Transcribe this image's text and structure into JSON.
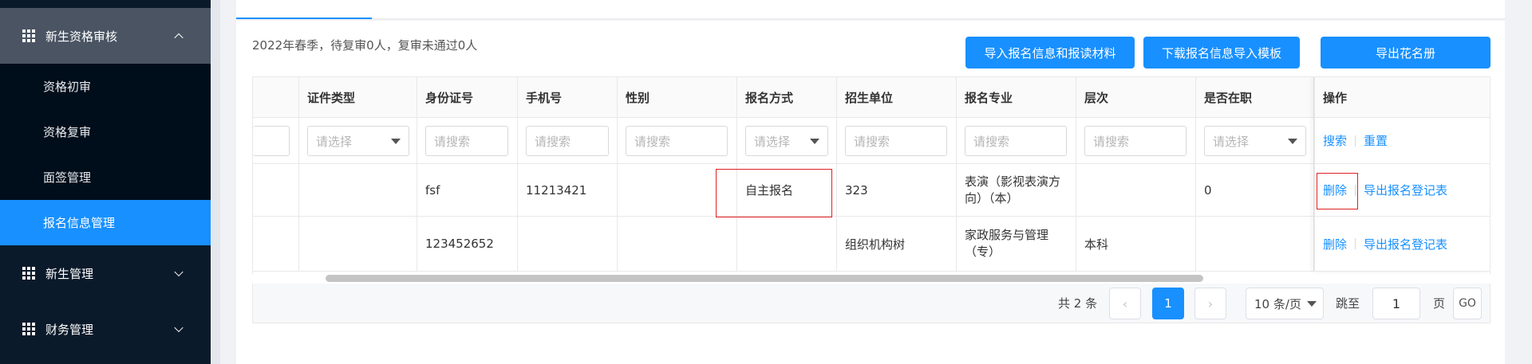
{
  "sidebar": {
    "groups": [
      {
        "label": "新生资格审核",
        "expanded": true
      },
      {
        "label": "新生管理",
        "expanded": false
      },
      {
        "label": "财务管理",
        "expanded": false
      }
    ],
    "items": [
      {
        "label": "资格初审"
      },
      {
        "label": "资格复审"
      },
      {
        "label": "面签管理"
      },
      {
        "label": "报名信息管理",
        "active": true
      }
    ]
  },
  "summary": "2022年春季，待复审0人，复审未通过0人",
  "toolbar": {
    "import_label": "导入报名信息和报读材料",
    "download_label": "下载报名信息导入模板",
    "export_label": "导出花名册"
  },
  "table": {
    "headers": [
      "证件类型",
      "身份证号",
      "手机号",
      "性别",
      "报名方式",
      "招生单位",
      "报名专业",
      "层次",
      "是否在职",
      "操作"
    ],
    "filters": {
      "select_placeholder": "请选择",
      "search_placeholder": "请搜索",
      "search_action": "搜索",
      "reset_action": "重置"
    },
    "rows": [
      {
        "cert_type": "",
        "id_no": "fsf",
        "phone": "11213421",
        "gender": "",
        "apply_method": "自主报名",
        "unit": "323",
        "major": "表演（影视表演方向）（本）",
        "level": "",
        "employed": "0"
      },
      {
        "cert_type": "",
        "id_no": "123452652",
        "phone": "",
        "gender": "",
        "apply_method": "",
        "unit": "组织机构树",
        "major": "家政服务与管理（专）",
        "level": "本科",
        "employed": ""
      }
    ],
    "row_actions": {
      "delete": "删除",
      "export": "导出报名登记表"
    }
  },
  "pagination": {
    "total": "共 2 条",
    "current_page": "1",
    "page_size": "10 条/页",
    "jump_label": "跳至",
    "jump_value": "1",
    "page_unit": "页",
    "go_label": "GO",
    "prev_icon": "‹",
    "next_icon": "›"
  },
  "colors": {
    "primary": "#1890ff",
    "sidebar": "#0b1a2b",
    "highlight": "#e02020"
  }
}
